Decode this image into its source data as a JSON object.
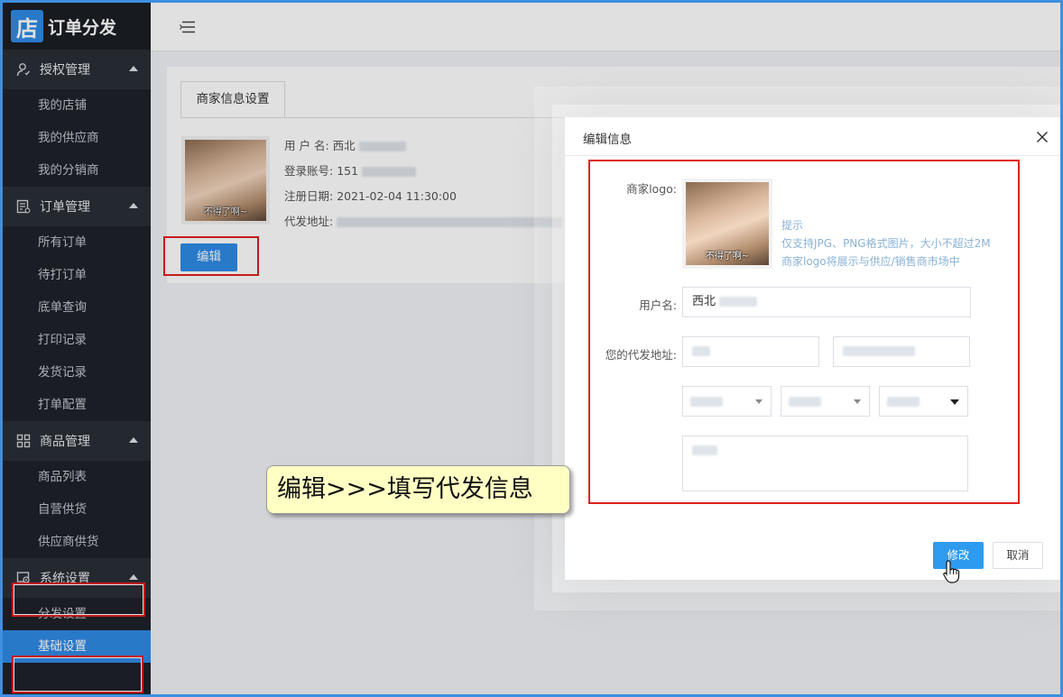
{
  "brand": {
    "logo_glyph": "店",
    "title": "订单分发",
    "accent": "#2f8ae5"
  },
  "sidebar": {
    "groups": [
      {
        "title": "授权管理",
        "icon": "user-icon",
        "items": [
          "我的店铺",
          "我的供应商",
          "我的分销商"
        ]
      },
      {
        "title": "订单管理",
        "icon": "order-list-icon",
        "items": [
          "所有订单",
          "待打订单",
          "底单查询",
          "打印记录",
          "发货记录",
          "打单配置"
        ]
      },
      {
        "title": "商品管理",
        "icon": "grid-icon",
        "items": [
          "商品列表",
          "自营供货",
          "供应商供货"
        ]
      },
      {
        "title": "系统设置",
        "icon": "settings-icon",
        "items": [
          "分发设置",
          "基础设置"
        ]
      }
    ],
    "active_item": "基础设置"
  },
  "main": {
    "tab_label": "商家信息设置",
    "avatar_caption": "不得了啊~",
    "info": {
      "username_label": "用 户 名:",
      "username_value": "西北",
      "account_label": "登录账号:",
      "account_value": "151",
      "date_label": "注册日期:",
      "date_value": "2021-02-04 11:30:00",
      "address_label": "代发地址:"
    },
    "edit_button": "编辑"
  },
  "modal": {
    "title": "编辑信息",
    "logo_label": "商家logo:",
    "avatar_caption": "不得了啊~",
    "hint_title": "提示",
    "hint_line1": "仅支持JPG、PNG格式图片，大小不超过2M",
    "hint_line2": "商家logo将展示与供应/销售商市场中",
    "username_label": "用户名:",
    "username_value": "西北",
    "address_label": "您的代发地址:",
    "submit_button": "修改",
    "cancel_button": "取消"
  },
  "callout": {
    "text": "编辑>>>填写代发信息"
  }
}
